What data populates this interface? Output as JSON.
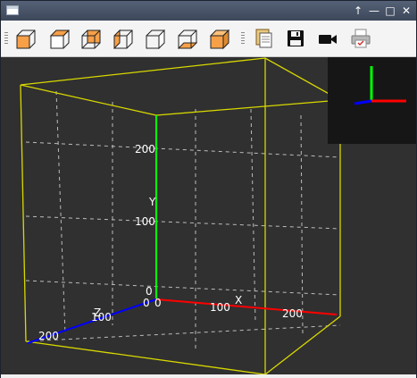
{
  "window": {
    "controls": [
      "↑",
      "—",
      "□",
      "✕"
    ]
  },
  "toolbar": {
    "tools": [
      {
        "icon": "cube-front-face-icon"
      },
      {
        "icon": "cube-top-face-icon"
      },
      {
        "icon": "cube-back-face-icon"
      },
      {
        "icon": "cube-left-face-icon"
      },
      {
        "icon": "cube-right-face-icon"
      },
      {
        "icon": "cube-bottom-face-icon"
      },
      {
        "icon": "cube-solid-icon"
      },
      {
        "icon": "copy-image-icon"
      },
      {
        "icon": "save-icon"
      },
      {
        "icon": "video-camera-icon"
      },
      {
        "icon": "print-icon"
      }
    ]
  },
  "plot": {
    "y_axis_label": "Y",
    "x_axis_label": "X",
    "z_axis_label": "Z",
    "y_ticks": [
      "200",
      "100",
      "0"
    ],
    "x_ticks": [
      "0",
      "100",
      "200"
    ],
    "z_ticks": [
      "0",
      "100",
      "200"
    ],
    "colors": {
      "x_axis": "#ff0000",
      "y_axis": "#00ff00",
      "z_axis": "#0000ff",
      "bounding_box": "#d8d800",
      "grid": "#bcbcbc",
      "background": "#303030"
    }
  }
}
